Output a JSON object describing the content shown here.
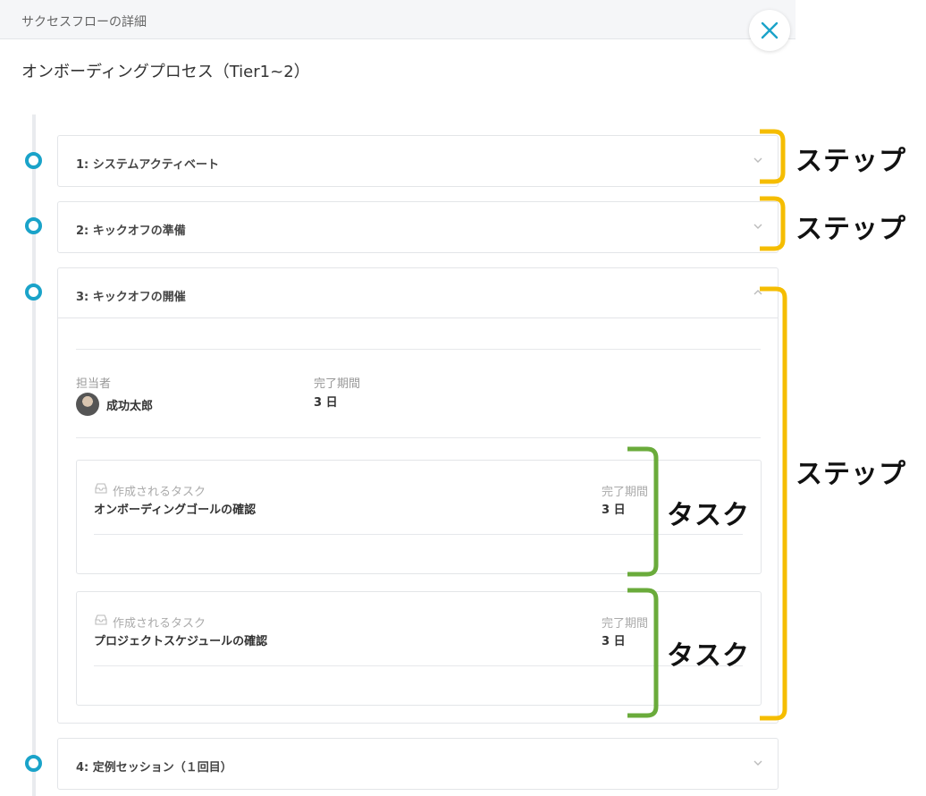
{
  "modal": {
    "header_title": "サクセスフローの詳細",
    "flow_title": "オンボーディングプロセス（Tier1~2）"
  },
  "steps": [
    {
      "label": "1: システムアクティベート",
      "expanded": false
    },
    {
      "label": "2: キックオフの準備",
      "expanded": false
    },
    {
      "label": "3: キックオフの開催",
      "expanded": true,
      "assignee_label": "担当者",
      "assignee_name": "成功太郎",
      "duration_label": "完了期間",
      "duration_value": "3 日",
      "tasks": [
        {
          "kind": "作成されるタスク",
          "name": "オンボーディングゴールの確認",
          "due_label": "完了期間",
          "due_value": "3 日"
        },
        {
          "kind": "作成されるタスク",
          "name": "プロジェクトスケジュールの確認",
          "due_label": "完了期間",
          "due_value": "3 日"
        }
      ]
    },
    {
      "label": "4: 定例セッション（１回目）",
      "expanded": false
    }
  ],
  "annotations": {
    "step": "ステップ",
    "task": "タスク"
  },
  "colors": {
    "accent": "#1aa3c9",
    "step_bracket": "#f5bd00",
    "task_bracket": "#6aab3b"
  }
}
